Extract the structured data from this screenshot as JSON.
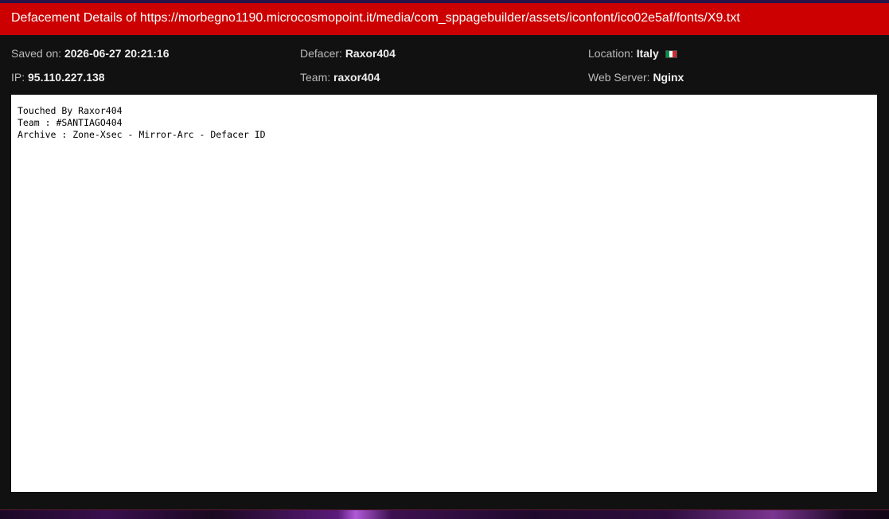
{
  "title": "Defacement Details of https://morbegno1190.microcosmopoint.it/media/com_sppagebuilder/assets/iconfont/ico02e5af/fonts/X9.txt",
  "info": {
    "saved_on": {
      "label": "Saved on:",
      "value": "2026-06-27 20:21:16"
    },
    "defacer": {
      "label": "Defacer:",
      "value": "Raxor404"
    },
    "location": {
      "label": "Location:",
      "value": "Italy",
      "flag": "italy-flag-icon"
    },
    "ip": {
      "label": "IP:",
      "value": "95.110.227.138"
    },
    "team": {
      "label": "Team:",
      "value": "raxor404"
    },
    "web_server": {
      "label": "Web Server:",
      "value": "Nginx"
    }
  },
  "content": {
    "text": "Touched By Raxor404\nTeam : #SANTIAGO404\nArchive : Zone-Xsec - Mirror-Arc - Defacer ID"
  },
  "colors": {
    "title_bar": "#cc0000",
    "panel_bg": "#111111",
    "label": "#bbbbbb",
    "value": "#eeeeee",
    "flag_green": "#009246",
    "flag_white": "#ffffff",
    "flag_red": "#ce2b37"
  }
}
